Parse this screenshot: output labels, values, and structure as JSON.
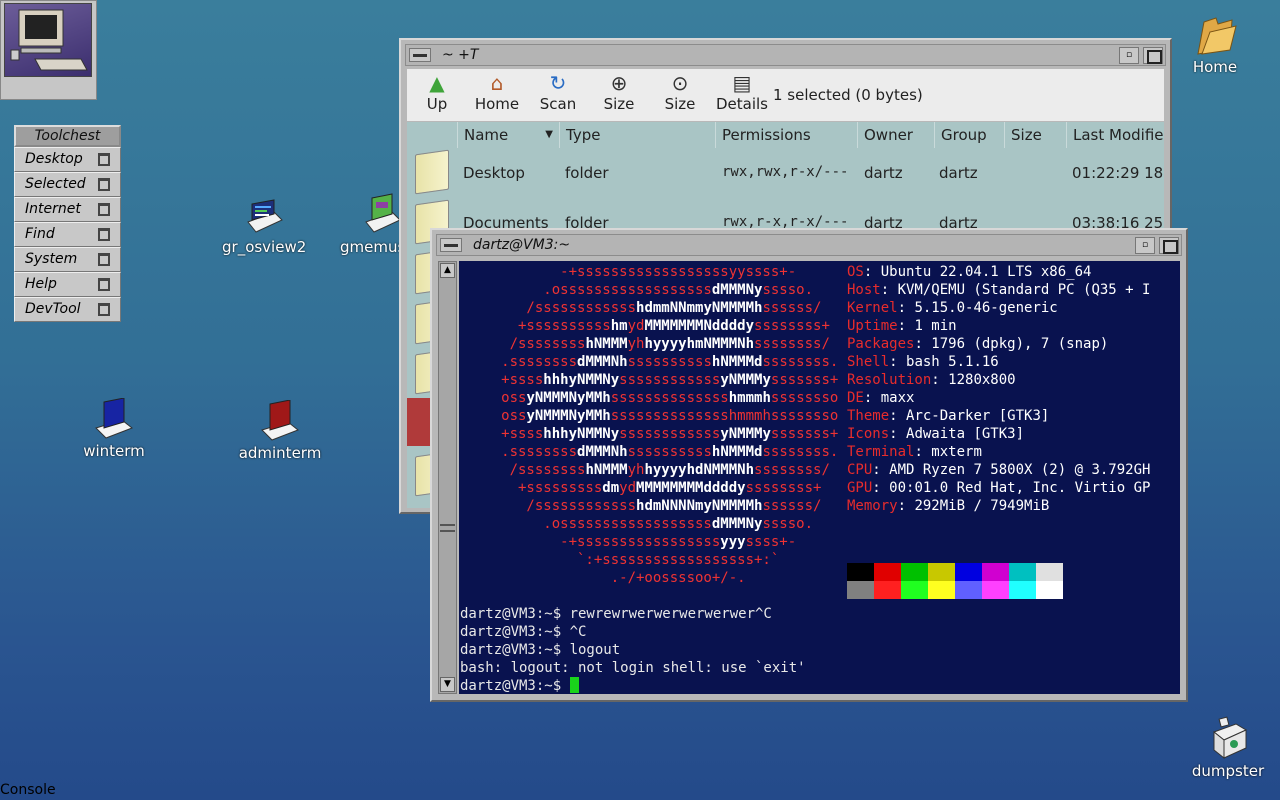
{
  "desktop": {
    "console_label": "Console",
    "icons": [
      {
        "label": "gr_osview2"
      },
      {
        "label": "gmemusage"
      },
      {
        "label": "winterm"
      },
      {
        "label": "adminterm"
      },
      {
        "label": "Home"
      },
      {
        "label": "dumpster"
      }
    ]
  },
  "toolchest": {
    "title": "Toolchest",
    "items": [
      "Desktop",
      "Selected",
      "Internet",
      "Find",
      "System",
      "Help",
      "DevTool"
    ]
  },
  "filemanager": {
    "title": "~ +T",
    "toolbar": [
      "Up",
      "Home",
      "Scan",
      "Size",
      "Size",
      "Details"
    ],
    "selection_info": "1 selected (0 bytes)",
    "columns": [
      "Name",
      "Type",
      "Permissions",
      "Owner",
      "Group",
      "Size",
      "Last Modified"
    ],
    "rows": [
      [
        "Desktop",
        "folder",
        "rwx,rwx,r-x/---",
        "dartz",
        "dartz",
        "",
        "01:22:29 18"
      ],
      [
        "Documents",
        "folder",
        "rwx,r-x,r-x/---",
        "dartz",
        "dartz",
        "",
        "03:38:16 25"
      ]
    ]
  },
  "terminal": {
    "title": "dartz@VM3:~",
    "info": [
      [
        "OS",
        "Ubuntu 22.04.1 LTS x86_64"
      ],
      [
        "Host",
        "KVM/QEMU (Standard PC (Q35 + I"
      ],
      [
        "Kernel",
        "5.15.0-46-generic"
      ],
      [
        "Uptime",
        "1 min"
      ],
      [
        "Packages",
        "1796 (dpkg), 7 (snap)"
      ],
      [
        "Shell",
        "bash 5.1.16"
      ],
      [
        "Resolution",
        "1280x800"
      ],
      [
        "DE",
        "maxx"
      ],
      [
        "Theme",
        "Arc-Darker [GTK3]"
      ],
      [
        "Icons",
        "Adwaita [GTK3]"
      ],
      [
        "Terminal",
        "mxterm"
      ],
      [
        "CPU",
        "AMD Ryzen 7 5800X (2) @ 3.792GH"
      ],
      [
        "GPU",
        "00:01.0 Red Hat, Inc. Virtio GP"
      ],
      [
        "Memory",
        "292MiB / 7949MiB"
      ]
    ],
    "palette_top": [
      "#000000",
      "#e00000",
      "#00c000",
      "#c8c800",
      "#0000e0",
      "#d000d0",
      "#00c0c0",
      "#e0e0e0"
    ],
    "palette_bottom": [
      "#808080",
      "#ff2020",
      "#20ff20",
      "#ffff20",
      "#6060ff",
      "#ff40ff",
      "#20ffff",
      "#ffffff"
    ],
    "shell_lines": [
      "dartz@VM3:~$ rewrewrwerwerwerwerwer^C",
      "dartz@VM3:~$ ^C",
      "dartz@VM3:~$ logout",
      "bash: logout: not login shell: use `exit'"
    ],
    "prompt": "dartz@VM3:~$ "
  }
}
